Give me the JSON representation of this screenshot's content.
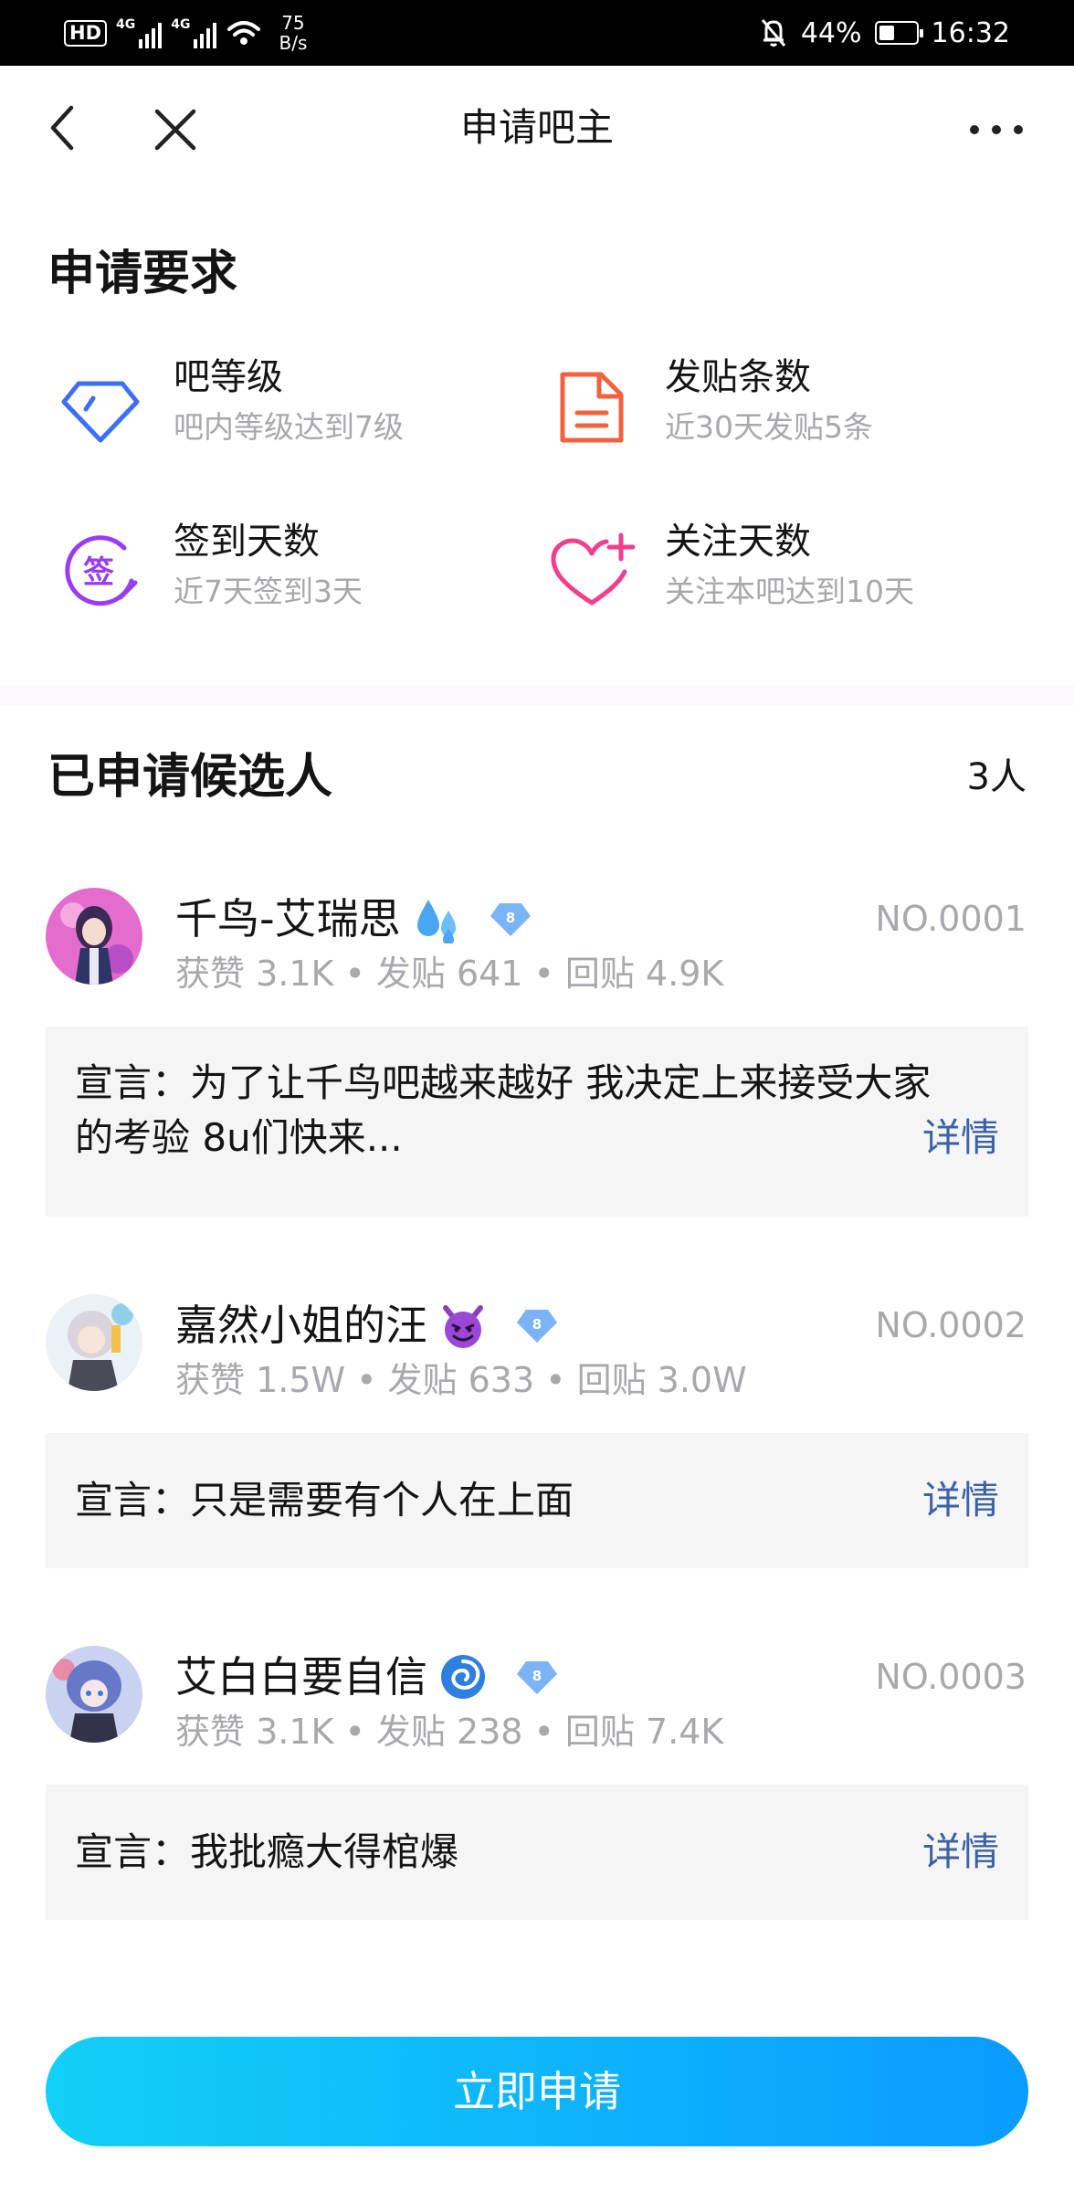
{
  "status_bar": {
    "hd": "HD",
    "net1": "4G",
    "net2": "4G",
    "speed_value": "75",
    "speed_unit": "B/s",
    "battery": "44%",
    "battery_level": 0.44,
    "time": "16:32"
  },
  "nav": {
    "title": "申请吧主"
  },
  "requirements": {
    "title": "申请要求",
    "items": [
      {
        "name": "吧等级",
        "desc": "吧内等级达到7级",
        "icon": "diamond-icon",
        "color": "#3d6ef7"
      },
      {
        "name": "发贴条数",
        "desc": "近30天发贴5条",
        "icon": "document-icon",
        "color": "#f2623e"
      },
      {
        "name": "签到天数",
        "desc": "近7天签到3天",
        "icon": "sign-in-icon",
        "color": "#9a3df2"
      },
      {
        "name": "关注天数",
        "desc": "关注本吧达到10天",
        "icon": "heart-plus-icon",
        "color": "#f23e8e"
      }
    ]
  },
  "candidates": {
    "title": "已申请候选人",
    "count": "3人",
    "items": [
      {
        "name": "千鸟-艾瑞思",
        "emoji": "sweat-droplets-icon",
        "level": "8",
        "no": "NO.0001",
        "likes": "获赞 3.1K",
        "posts": "发贴 641",
        "replies": "回贴 4.9K",
        "manifesto_line1": "宣言：为了让千鸟吧越来越好 我决定上来接受大家",
        "manifesto_line2": "的考验 8u们快来...",
        "details": "详情"
      },
      {
        "name": "嘉然小姐的汪",
        "emoji": "smiling-devil-icon",
        "level": "8",
        "no": "NO.0002",
        "likes": "获赞 1.5W",
        "posts": "发贴 633",
        "replies": "回贴 3.0W",
        "manifesto": "宣言：只是需要有个人在上面",
        "details": "详情"
      },
      {
        "name": "艾白白要自信",
        "emoji": "cyclone-icon",
        "level": "8",
        "no": "NO.0003",
        "likes": "获赞 3.1K",
        "posts": "发贴 238",
        "replies": "回贴 7.4K",
        "manifesto": "宣言：我批瘾大得棺爆",
        "details": "详情"
      }
    ]
  },
  "apply_button": "立即申请",
  "stats_separator": "•"
}
